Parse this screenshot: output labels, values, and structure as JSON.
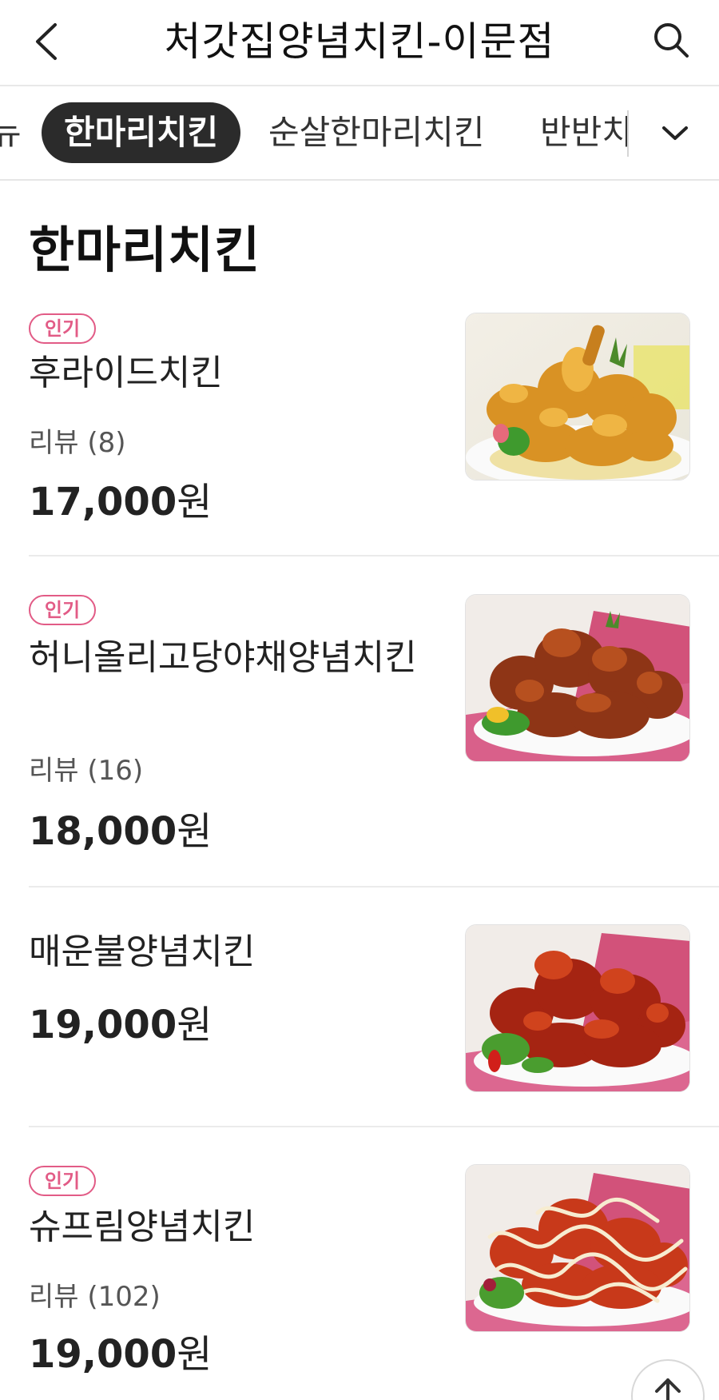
{
  "header": {
    "title": "처갓집양념치킨-이문점",
    "back_icon": "chevron-left-icon",
    "search_icon": "search-icon"
  },
  "tabs": {
    "items": [
      {
        "label": "뉴",
        "active": false
      },
      {
        "label": "한마리치킨",
        "active": true
      },
      {
        "label": "순살한마리치킨",
        "active": false
      },
      {
        "label": "반반치",
        "active": false
      }
    ],
    "expand_icon": "chevron-down-icon"
  },
  "section": {
    "title": "한마리치킨"
  },
  "menu": [
    {
      "badge": "인기",
      "name": "후라이드치킨",
      "review": "리뷰 (8)",
      "price": "17,000",
      "currency": "원"
    },
    {
      "badge": "인기",
      "name": "허니올리고당야채양념치킨",
      "review": "리뷰 (16)",
      "price": "18,000",
      "currency": "원"
    },
    {
      "badge": "",
      "name": "매운불양념치킨",
      "review": "",
      "price": "19,000",
      "currency": "원"
    },
    {
      "badge": "인기",
      "name": "슈프림양념치킨",
      "review": "리뷰 (102)",
      "price": "19,000",
      "currency": "원"
    }
  ],
  "colors": {
    "accent_pink": "#e25b86",
    "active_tab_bg": "#2b2b2b"
  },
  "scroll_top_icon": "arrow-up-icon"
}
